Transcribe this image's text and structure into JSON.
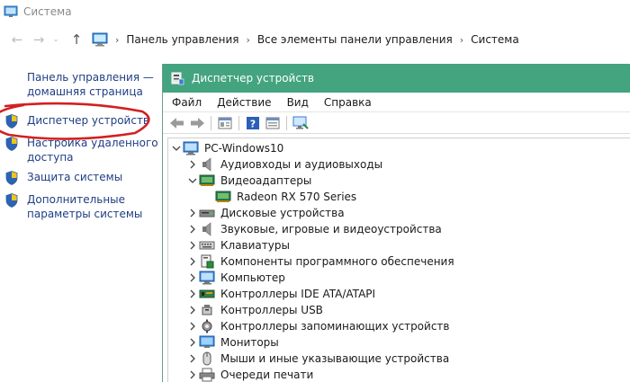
{
  "window": {
    "title": "Система"
  },
  "address": {
    "crumbs": [
      "Панель управления",
      "Все элементы панели управления",
      "Система"
    ]
  },
  "sidebar": {
    "home": "Панель управления — домашняя страница",
    "items": [
      {
        "label": "Диспетчер устройств",
        "highlighted": true
      },
      {
        "label": "Настройка удаленного доступа"
      },
      {
        "label": "Защита системы"
      },
      {
        "label": "Дополнительные параметры системы"
      }
    ],
    "highlight_color": "#d41f1f"
  },
  "device_manager": {
    "title": "Диспетчер устройств",
    "titlebar_color": "#43a47f",
    "menu": [
      "Файл",
      "Действие",
      "Вид",
      "Справка"
    ],
    "toolbar_icons": [
      "back-icon",
      "forward-icon",
      "properties-icon",
      "help-icon",
      "view-icon",
      "monitor-scan-icon"
    ],
    "tree": {
      "root": "PC-Windows10",
      "items": [
        {
          "label": "Аудиовходы и аудиовыходы",
          "icon": "speaker-icon",
          "expanded": false
        },
        {
          "label": "Видеоадаптеры",
          "icon": "display-adapter-icon",
          "expanded": true,
          "children": [
            {
              "label": "Radeon RX 570 Series",
              "icon": "display-adapter-icon"
            }
          ]
        },
        {
          "label": "Дисковые устройства",
          "icon": "disk-drive-icon",
          "expanded": false
        },
        {
          "label": "Звуковые, игровые и видеоустройства",
          "icon": "speaker-icon",
          "expanded": false
        },
        {
          "label": "Клавиатуры",
          "icon": "keyboard-icon",
          "expanded": false
        },
        {
          "label": "Компоненты программного обеспечения",
          "icon": "software-component-icon",
          "expanded": false
        },
        {
          "label": "Компьютер",
          "icon": "computer-icon",
          "expanded": false
        },
        {
          "label": "Контроллеры IDE ATA/ATAPI",
          "icon": "ide-controller-icon",
          "expanded": false
        },
        {
          "label": "Контроллеры USB",
          "icon": "usb-icon",
          "expanded": false
        },
        {
          "label": "Контроллеры запоминающих устройств",
          "icon": "storage-controller-icon",
          "expanded": false
        },
        {
          "label": "Мониторы",
          "icon": "monitor-icon",
          "expanded": false
        },
        {
          "label": "Мыши и иные указывающие устройства",
          "icon": "mouse-icon",
          "expanded": false
        },
        {
          "label": "Очереди печати",
          "icon": "printer-icon",
          "expanded": false
        }
      ]
    }
  }
}
